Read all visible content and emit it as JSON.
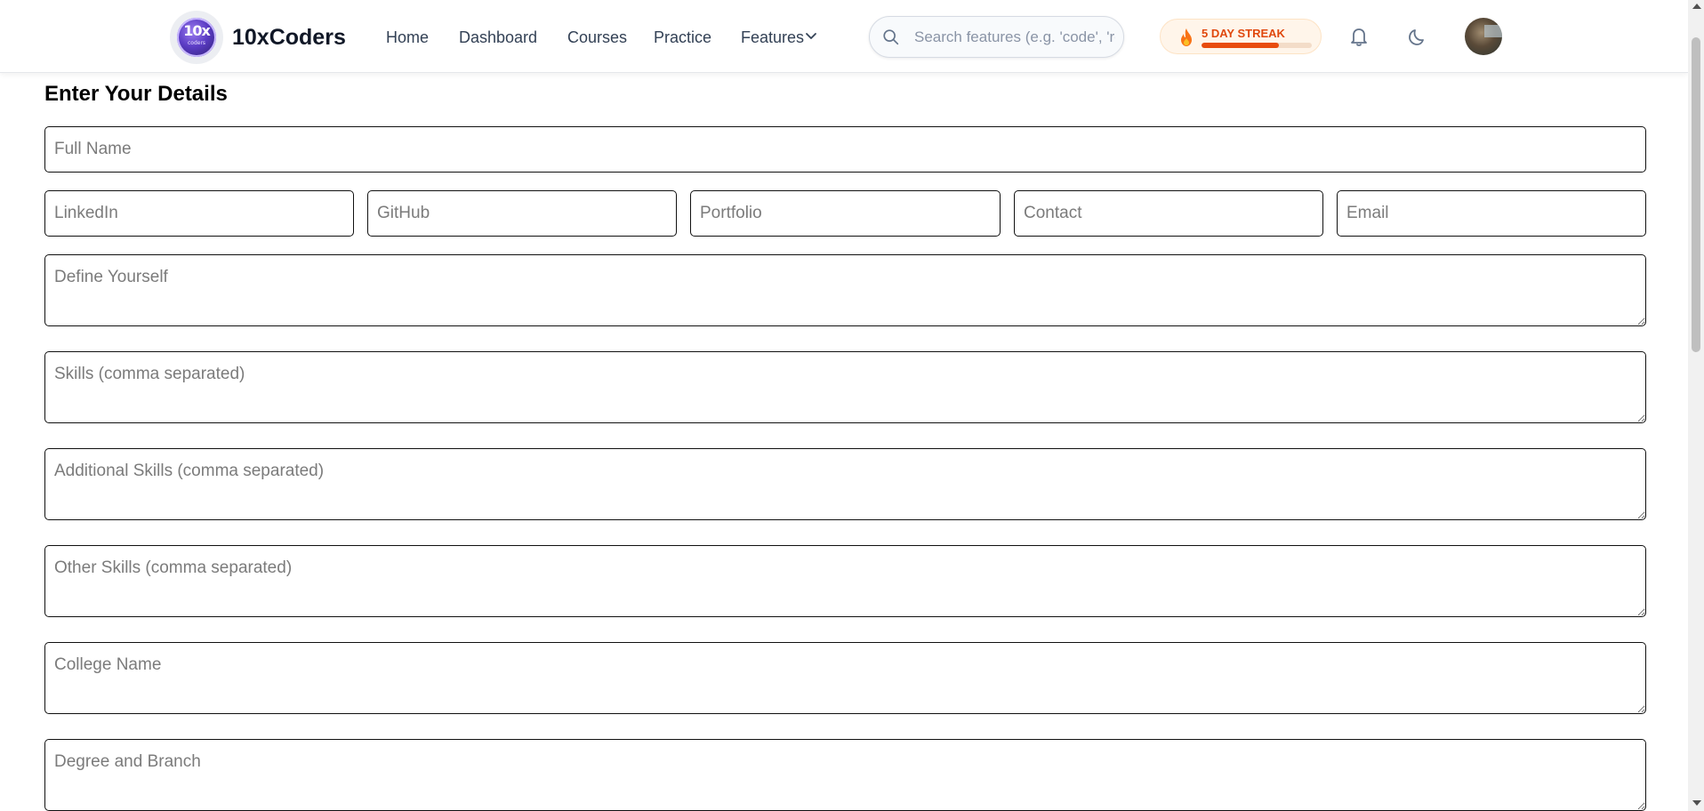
{
  "navbar": {
    "logo": {
      "main_text": "10x",
      "sub_text": "coders"
    },
    "brand": "10xCoders",
    "links": [
      {
        "label": "Home"
      },
      {
        "label": "Dashboard"
      },
      {
        "label": "Courses"
      },
      {
        "label": "Practice"
      },
      {
        "label": "Features",
        "icon": "chevron-down-icon"
      }
    ],
    "search": {
      "placeholder": "Search features (e.g. 'code', 'resume')",
      "icon": "search-icon"
    },
    "streak": {
      "label": "5 DAY STREAK",
      "icon": "flame-icon",
      "progress": 0.7,
      "color": "#e84c0e"
    },
    "notifications_icon": "bell-icon",
    "theme_icon": "moon-icon",
    "avatar": "user-avatar"
  },
  "form": {
    "title": "Enter Your Details",
    "full_name": {
      "placeholder": "Full Name",
      "value": ""
    },
    "links_row": [
      {
        "placeholder": "LinkedIn",
        "value": ""
      },
      {
        "placeholder": "GitHub",
        "value": ""
      },
      {
        "placeholder": "Portfolio",
        "value": ""
      },
      {
        "placeholder": "Contact",
        "value": ""
      },
      {
        "placeholder": "Email",
        "value": ""
      }
    ],
    "textareas": [
      {
        "placeholder": "Define Yourself",
        "value": ""
      },
      {
        "placeholder": "Skills (comma separated)",
        "value": ""
      },
      {
        "placeholder": "Additional Skills (comma separated)",
        "value": ""
      },
      {
        "placeholder": "Other Skills (comma separated)",
        "value": ""
      },
      {
        "placeholder": "College Name",
        "value": ""
      },
      {
        "placeholder": "Degree and Branch",
        "value": ""
      }
    ]
  }
}
